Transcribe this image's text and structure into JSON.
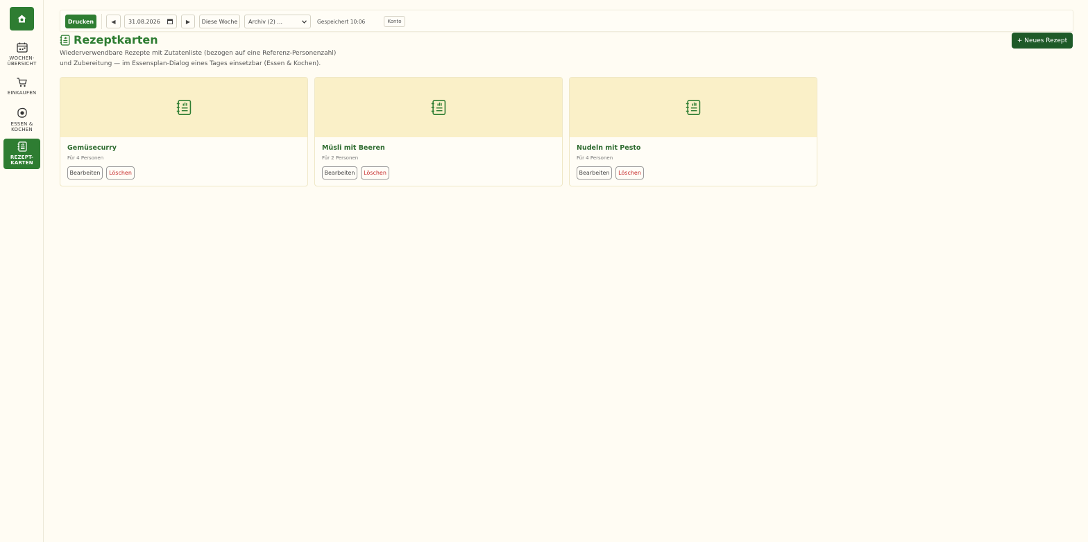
{
  "colors": {
    "accent": "#2e7d32",
    "accent_dark": "#1e5a28",
    "danger": "#c62828",
    "card_image_bg": "#faf0c8",
    "page_bg": "#fffcf3"
  },
  "sidebar": {
    "home_icon": "house-icon",
    "items": [
      {
        "label": "WOCHEN-\nÜBERSICHT",
        "icon": "calendar-icon",
        "active": false
      },
      {
        "label": "EINKAUFEN",
        "icon": "cart-icon",
        "active": false
      },
      {
        "label": "ESSEN &\nKOCHEN",
        "icon": "fried-egg-icon",
        "active": false
      },
      {
        "label": "REZEPT-\nKARTEN",
        "icon": "recipe-book-icon",
        "active": true
      }
    ]
  },
  "toolbar": {
    "print_label": "Drucken",
    "prev_label": "◀",
    "date_value": "31.08.2026",
    "next_label": "▶",
    "this_week_label": "Diese Woche",
    "archive_selected": "Archiv (2) ...",
    "saved_status": "Gespeichert 10:06",
    "account_label": "Konto"
  },
  "header": {
    "title": "Rezeptkarten",
    "subtitle_line1": "Wiederverwendbare Rezepte mit Zutatenliste (bezogen auf eine Referenz-Personenzahl)",
    "subtitle_line2": "und Zubereitung — im Essensplan-Dialog eines Tages einsetzbar (Essen & Kochen).",
    "new_recipe_label": "+ Neues Rezept"
  },
  "recipes": [
    {
      "title": "Gemüsecurry",
      "servings": "Für 4 Personen",
      "edit_label": "Bearbeiten",
      "delete_label": "Löschen"
    },
    {
      "title": "Müsli mit Beeren",
      "servings": "Für 2 Personen",
      "edit_label": "Bearbeiten",
      "delete_label": "Löschen"
    },
    {
      "title": "Nudeln mit Pesto",
      "servings": "Für 4 Personen",
      "edit_label": "Bearbeiten",
      "delete_label": "Löschen"
    }
  ]
}
